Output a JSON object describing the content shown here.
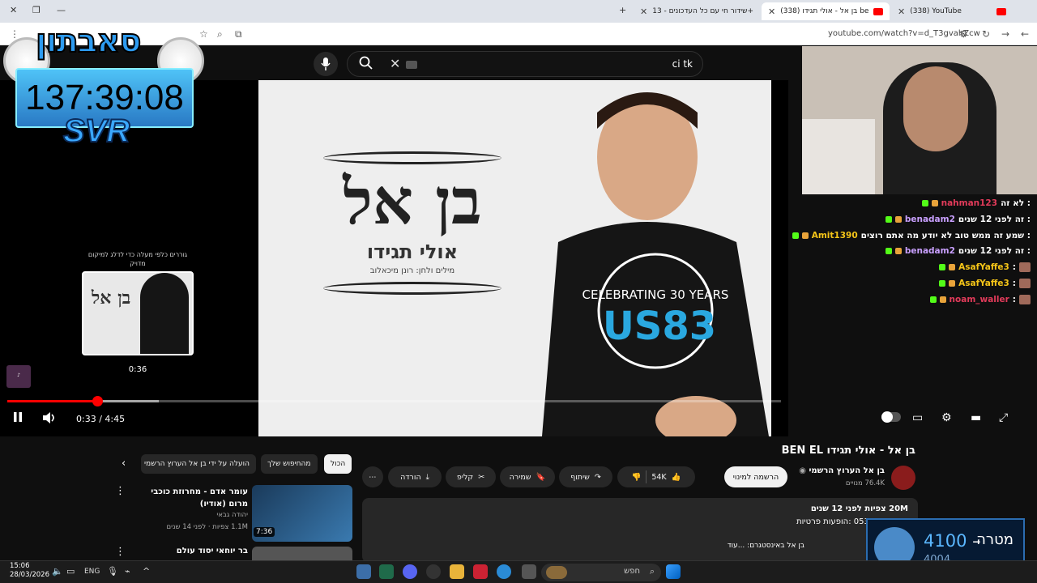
{
  "browser": {
    "tabs": [
      {
        "label": "(338) YouTube",
        "active": false
      },
      {
        "label": "(338) בן אל - אולי תגידו be",
        "active": true
      },
      {
        "label": "שידור חי עם כל העדכונים - 13+",
        "active": false
      }
    ],
    "url": "youtube.com/watch?v=d_T3gvahZcw"
  },
  "search": {
    "value": "ci tk"
  },
  "overlay": {
    "logo_text": "סאבתון",
    "timer": "137:39:08",
    "tag": "SVR"
  },
  "video": {
    "art_title": "בן אל",
    "art_subtitle": "אולי תגידו",
    "art_credit": "מילים ולחן: רונן מיכאלוב",
    "shirt_text": "CELEBRATING 30 YEARS",
    "shirt_logo": "US83",
    "preview_hint": "גוררים כלפי מעלה כדי לדלג למיקום מדויק",
    "preview_time": "0:36",
    "current_time": "0:33",
    "duration": "4:45",
    "played_fraction": 0.116,
    "buffer_fraction": 0.196
  },
  "chat": [
    {
      "user": "nahman123",
      "color": "#e23b5a",
      "msg": "לא זה :"
    },
    {
      "user": "benadam2",
      "color": "#c9a0ff",
      "msg": "זה לפני 12 שנים :"
    },
    {
      "user": "Amit1390",
      "color": "#f5c518",
      "msg": "שמע זה ממש טוב לא יודע מה אתם רוצים :"
    },
    {
      "user": "benadam2",
      "color": "#c9a0ff",
      "msg": "זה לפני 12 שנים :"
    },
    {
      "user": "AsafYaffe3",
      "color": "#f5c518",
      "msg": ":"
    },
    {
      "user": "AsafYaffe3",
      "color": "#f5c518",
      "msg": ":"
    },
    {
      "user": "noam_waller",
      "color": "#e23b5a",
      "msg": ":"
    }
  ],
  "watch": {
    "title": "בן אל - אולי תגידו BEN EL",
    "channel": "בן אל הערוץ הרשמי",
    "subs": "76.4K מנויים",
    "subscribe": "הרשמה למינוי",
    "likes": "54K",
    "share": "שיתוף",
    "save": "שמירה",
    "clip": "קליפ",
    "download": "הורדה",
    "stats": "20M צפיות  לפני 12 שנים",
    "phone": "053-3437226 :הופעות פרטיות",
    "more": "...עוד",
    "more_prefix": "בן אל באינסטגרם:"
  },
  "chips": [
    "הכול",
    "מהחיפוש שלך",
    "הועלה על ידי בן אל הערוץ הרשמי"
  ],
  "related": [
    {
      "title": "עומר אדם - מחרוזת כוכבי מרום (אודיו)",
      "channel": "יהודה גבאי",
      "meta": "1.1M צפיות · לפני 14 שנים",
      "duration": "7:36"
    },
    {
      "title": "בר יוחאי יסוד עולם"
    }
  ],
  "goal": {
    "label": "מטרה",
    "target": "4100",
    "current": "4004"
  },
  "taskbar": {
    "time": "15:06",
    "date": "28/03/2026",
    "lang": "ENG",
    "search": "חפש"
  }
}
